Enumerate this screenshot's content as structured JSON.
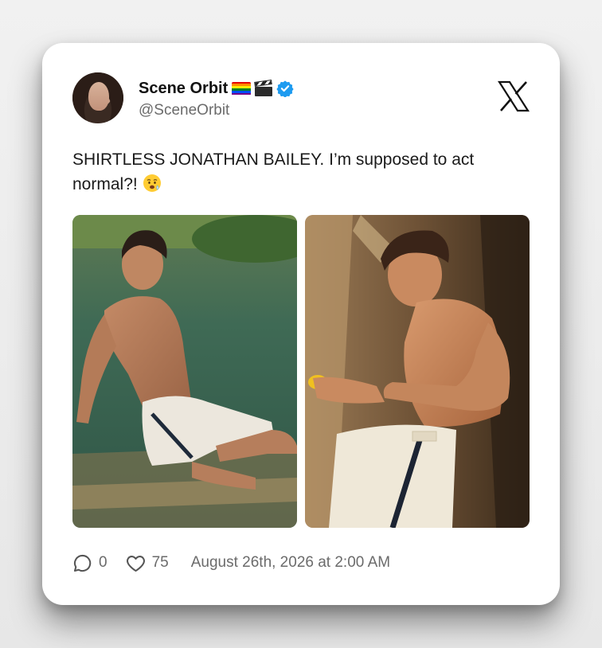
{
  "post": {
    "display_name": "Scene Orbit",
    "handle": "@SceneOrbit",
    "verified": true,
    "name_emojis": [
      "rainbow-flag-emoji",
      "clapper-board-emoji"
    ],
    "text": "SHIRTLESS JONATHAN BAILEY. I’m supposed to act normal?!",
    "text_emoji": "anxious-face-emoji",
    "platform_logo": "x-logo-icon"
  },
  "media": [
    {
      "name": "photo-left",
      "description_icon": "photo"
    },
    {
      "name": "photo-right",
      "description_icon": "photo"
    }
  ],
  "stats": {
    "replies": "0",
    "likes": "75",
    "timestamp": "August 26th, 2026 at 2:00 AM"
  },
  "colors": {
    "verified": "#1d9bf0",
    "text_primary": "#1a1a1a",
    "text_secondary": "#6b6b6b",
    "card_bg": "#ffffff"
  }
}
